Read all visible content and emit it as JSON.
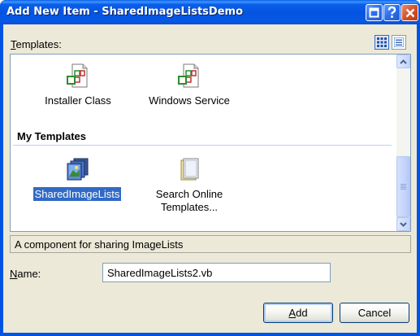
{
  "window": {
    "title": "Add New Item - SharedImageListsDemo"
  },
  "templates_label": {
    "accel": "T",
    "rest": "emplates:"
  },
  "items": [
    {
      "label": "Installer Class",
      "icon": "installer-class-icon"
    },
    {
      "label": "Windows Service",
      "icon": "windows-service-icon"
    }
  ],
  "my_templates": {
    "header": "My Templates",
    "items": [
      {
        "label": "SharedImageLists",
        "icon": "shared-image-lists-icon",
        "selected": true
      },
      {
        "label_line1": "Search Online",
        "label_line2": "Templates...",
        "icon": "search-online-templates-icon"
      }
    ]
  },
  "description": "A component for sharing ImageLists",
  "name_label": {
    "accel": "N",
    "rest": "ame:"
  },
  "name_value": "SharedImageLists2.vb",
  "buttons": {
    "add_accel": "A",
    "add_rest": "dd",
    "cancel": "Cancel"
  },
  "colors": {
    "title_bar": "#0054e3",
    "selection": "#316ac5",
    "dialog_face": "#ece9d8"
  }
}
